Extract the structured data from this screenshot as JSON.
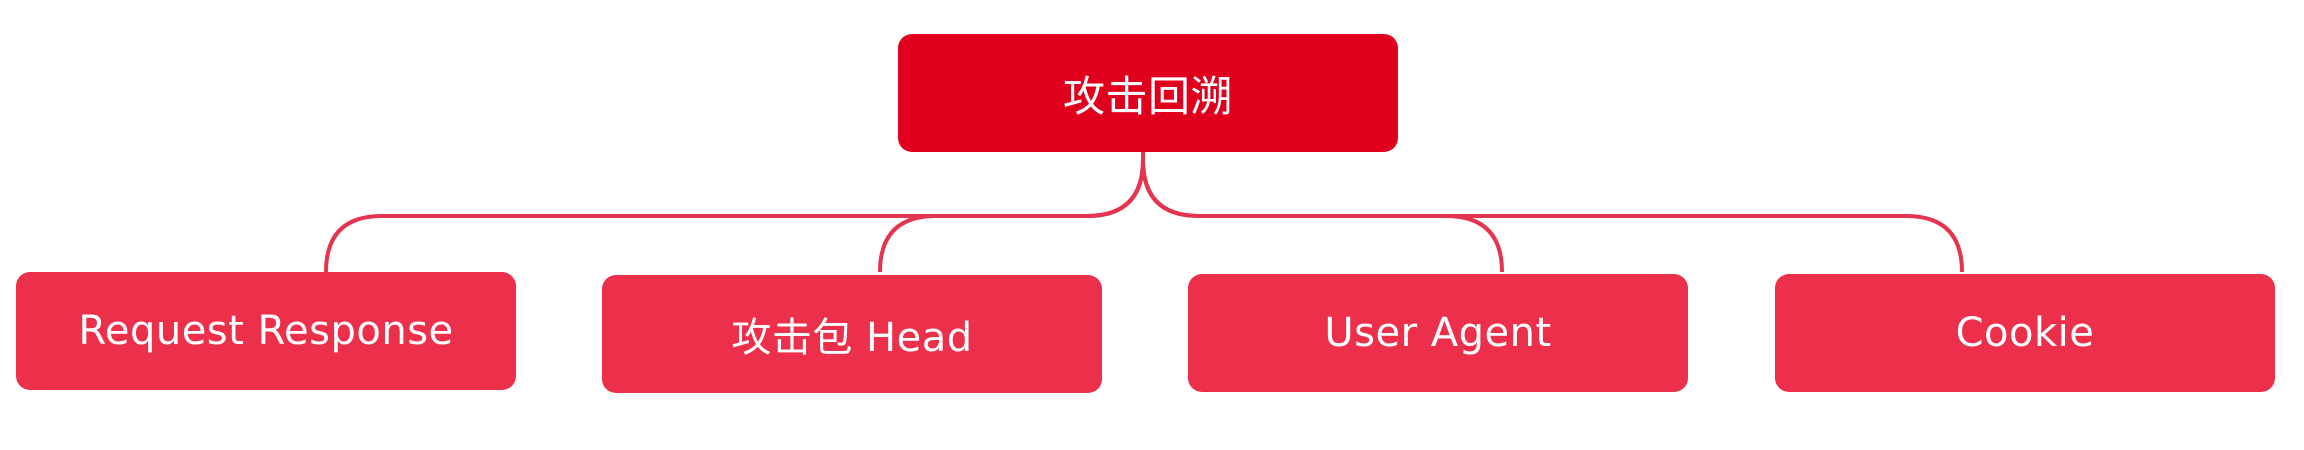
{
  "colors": {
    "root_fill": "#E0001E",
    "child_fill": "#EC2F4B",
    "connector": "#E53450",
    "text": "#FFFFFF"
  },
  "root": {
    "label": "攻击回溯"
  },
  "children": [
    {
      "label": "Request Response"
    },
    {
      "label": "攻击包 Head"
    },
    {
      "label": "User Agent"
    },
    {
      "label": "Cookie"
    }
  ]
}
